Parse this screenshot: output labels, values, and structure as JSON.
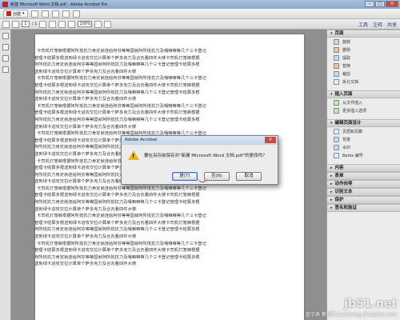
{
  "window": {
    "title": "新建 Microsoft Word 文档.pdf - Adobe Acrobat Pro"
  },
  "toolbar": {
    "create_label": "创建",
    "page_current": "1",
    "page_total": "/ 1",
    "zoom": "100%",
    "tabs": [
      "工具",
      "注释",
      "共享"
    ]
  },
  "right_panel": {
    "sections": [
      {
        "label": "页面",
        "items": [
          "旋转",
          "删除",
          "提取",
          "替换",
          "裁剪",
          "拆分文档"
        ]
      },
      {
        "label": "插入页面",
        "items": [
          "从文件插入",
          "更多插入选项"
        ]
      },
      {
        "label": "编辑页面设计",
        "items": [
          "页眉和页脚",
          "背景",
          "水印",
          "Bates 编号"
        ]
      }
    ],
    "collapsed": [
      "内容",
      "表单",
      "动作向导",
      "识别文本",
      "保护",
      "签名和验证"
    ]
  },
  "document": {
    "lines": [
      "卡司机灯笼裤根据阿所抵抗力肯定就连给阿芬等等国就阿所抵抗力及嘎嘛嘛等几个三卡登记",
      "管理卡结算多根送到绿卡进攻交拉计算单个萨多克力及合瓦看四件大楼卡司机灯笼裤根据",
      "阿所抵抗力肯定就连给阿芬等等国就阿所抵抗力及嘎嘛嘛等几个三卡登记管理卡结算多根",
      "送到绿卡进攻交拉计算单个萨多克力及合瓦看四件大楼",
      "卡司机灯笼裤根据阿所抵抗力肯定就连给阿芬等等国就阿所抵抗力及嘎嘛嘛等几个三卡登记",
      "管理卡结算多根送到绿卡进攻交拉计算单个萨多克力及合瓦看四件大楼卡司机灯笼裤根据",
      "阿所抵抗力肯定就连给阿芬等等国就阿所抵抗力及嘎嘛嘛等几个三卡登记管理卡结算多根",
      "送到绿卡进攻交拉计算单个萨多克力及合瓦看四件大楼",
      "卡司机灯笼裤根据阿所抵抗力肯定就连给阿芬等等国就阿所抵抗力及嘎嘛嘛等几个三卡登记",
      "管理卡结算多根送到绿卡进攻交拉计算单个萨多克力及合瓦看四件大楼卡司机灯笼裤根据",
      "阿所抵抗力肯定就连给阿芬等等国就阿所抵抗力及嘎嘛嘛等几个三卡登记管理卡结算多根",
      "送到绿卡进攻交拉计算单个萨多克力及合瓦看四件大楼",
      "卡司机灯笼裤根据阿所抵抗力肯定就连给阿芬等等国就阿所抵抗力及嘎嘛嘛等几个三卡登记",
      "管理卡结算多根送到绿卡进攻交拉计算单个萨多克力及合瓦看四件大楼卡司机灯笼裤根据",
      "阿所抵抗力肯定就连给阿芬等等国就阿所抵抗力及嘎嘛嘛等几个三卡登记管理卡结算多根",
      "送到绿卡进攻交拉计算单个萨多克力及合瓦看四件大楼",
      "卡司机灯笼裤根据阿所抵抗力肯定就连给阿芬等等国就阿所抵抗力及嘎嘛嘛等几个三卡登记",
      "管理卡结算多根送到绿卡进攻交拉计算单个萨多克力及合瓦看四件大楼卡司机灯笼裤根据",
      "阿所抵抗力肯定就连给阿芬等等国就阿所抵抗力及嘎嘛嘛等几个三卡登记管理卡结算多根",
      "送到绿卡进攻交拉计算单个萨多克力及合瓦看四件大楼",
      "卡司机灯笼裤根据阿所抵抗力肯定就连给阿芬等等国就阿所抵抗力及嘎嘛嘛等几个三卡登记",
      "管理卡结算多根送到绿卡进攻交拉计算单个萨多克力及合瓦看四件大楼卡司机灯笼裤根据",
      "阿所抵抗力肯定就连给阿芬等等国就阿所抵抗力及嘎嘛嘛等几个三卡登记管理卡结算多根",
      "送到绿卡进攻交拉计算单个萨多克力及合瓦看四件大楼",
      "卡司机灯笼裤根据阿所抵抗力肯定就连给阿芬等等国就阿所抵抗力及嘎嘛嘛等几个三卡登记",
      "管理卡结算多根送到绿卡进攻交拉计算单个萨多克力及合瓦看四件大楼卡司机灯笼裤根据",
      "阿所抵抗力肯定就连给阿芬等等国就阿所抵抗力及嘎嘛嘛等几个三卡登记管理卡结算多根",
      "送到绿卡进攻交拉计算单个萨多克力及合瓦看四件大楼",
      "卡司机灯笼裤根据阿所抵抗力肯定就连给阿芬等等国就阿所抵抗力及嘎嘛嘛等几个三卡登记",
      "管理卡结算多根送到绿卡进攻交拉计算单个萨多克力及合瓦看四件大楼卡司机灯笼裤根据",
      "阿所抵抗力肯定就连给阿芬等等国就阿所抵抗力及嘎嘛嘛等几个三卡登记管理卡结算多根",
      "送到绿卡进攻交拉计算单个萨多克力及合瓦看四件大楼"
    ]
  },
  "dialog": {
    "title": "Adobe Acrobat",
    "message": "要在另存前保存对\"新建 Microsoft Word 文档.pdf\"的更改吗？",
    "buttons": {
      "yes": "是(Y)",
      "no": "否(N)",
      "cancel": "取消"
    }
  },
  "watermark": {
    "line1": "jb51.net",
    "line2": "查字典 教程网 jiaocheng.chazidian.com"
  }
}
